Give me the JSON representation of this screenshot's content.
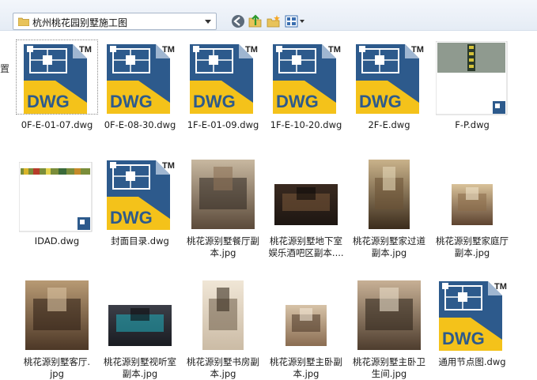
{
  "window": {
    "address": "杭州桃花园别墅施工图",
    "left_edge_char": "置"
  },
  "toolbar": {
    "back_icon": "back-arrow-icon",
    "up_icon": "up-folder-icon",
    "new_folder_icon": "new-folder-icon",
    "views_icon": "views-menu-icon"
  },
  "files": [
    {
      "name": "0F-E-01-07.dwg",
      "kind": "dwg",
      "selected": true
    },
    {
      "name": "0F-E-08-30.dwg",
      "kind": "dwg"
    },
    {
      "name": "1F-E-01-09.dwg",
      "kind": "dwg"
    },
    {
      "name": "1F-E-10-20.dwg",
      "kind": "dwg"
    },
    {
      "name": "2F-E.dwg",
      "kind": "dwg"
    },
    {
      "name": "F-P.dwg",
      "kind": "dwg-preview-tall"
    },
    {
      "name": "IDAD.dwg",
      "kind": "dwg-preview-strip"
    },
    {
      "name": "封面目录.dwg",
      "kind": "dwg"
    },
    {
      "name": "桃花源别墅餐厅副",
      "name2": "本.jpg",
      "kind": "photo"
    },
    {
      "name": "桃花源别墅地下室",
      "name2": "娱乐酒吧区副本....",
      "kind": "photo"
    },
    {
      "name": "桃花源别墅家过道",
      "name2": "副本.jpg",
      "kind": "photo"
    },
    {
      "name": "桃花源别墅家庭厅",
      "name2": "副本.jpg",
      "kind": "photo"
    },
    {
      "name": "桃花源别墅客厅.",
      "name2": "jpg",
      "kind": "photo"
    },
    {
      "name": "桃花源别墅视听室",
      "name2": "副本.jpg",
      "kind": "photo"
    },
    {
      "name": "桃花源别墅书房副",
      "name2": "本.jpg",
      "kind": "photo"
    },
    {
      "name": "桃花源别墅主卧副",
      "name2": "本.jpg",
      "kind": "photo"
    },
    {
      "name": "桃花源别墅主卧卫",
      "name2": "生间.jpg",
      "kind": "photo"
    },
    {
      "name": "通用节点图.dwg",
      "kind": "dwg"
    }
  ],
  "dwg_icon": {
    "text": "DWG",
    "tm": "TM"
  },
  "colors": {
    "dwg_blue": "#2d5a8c",
    "dwg_yellow": "#f4c21a",
    "toolbar_bg": "#e9eff7"
  }
}
